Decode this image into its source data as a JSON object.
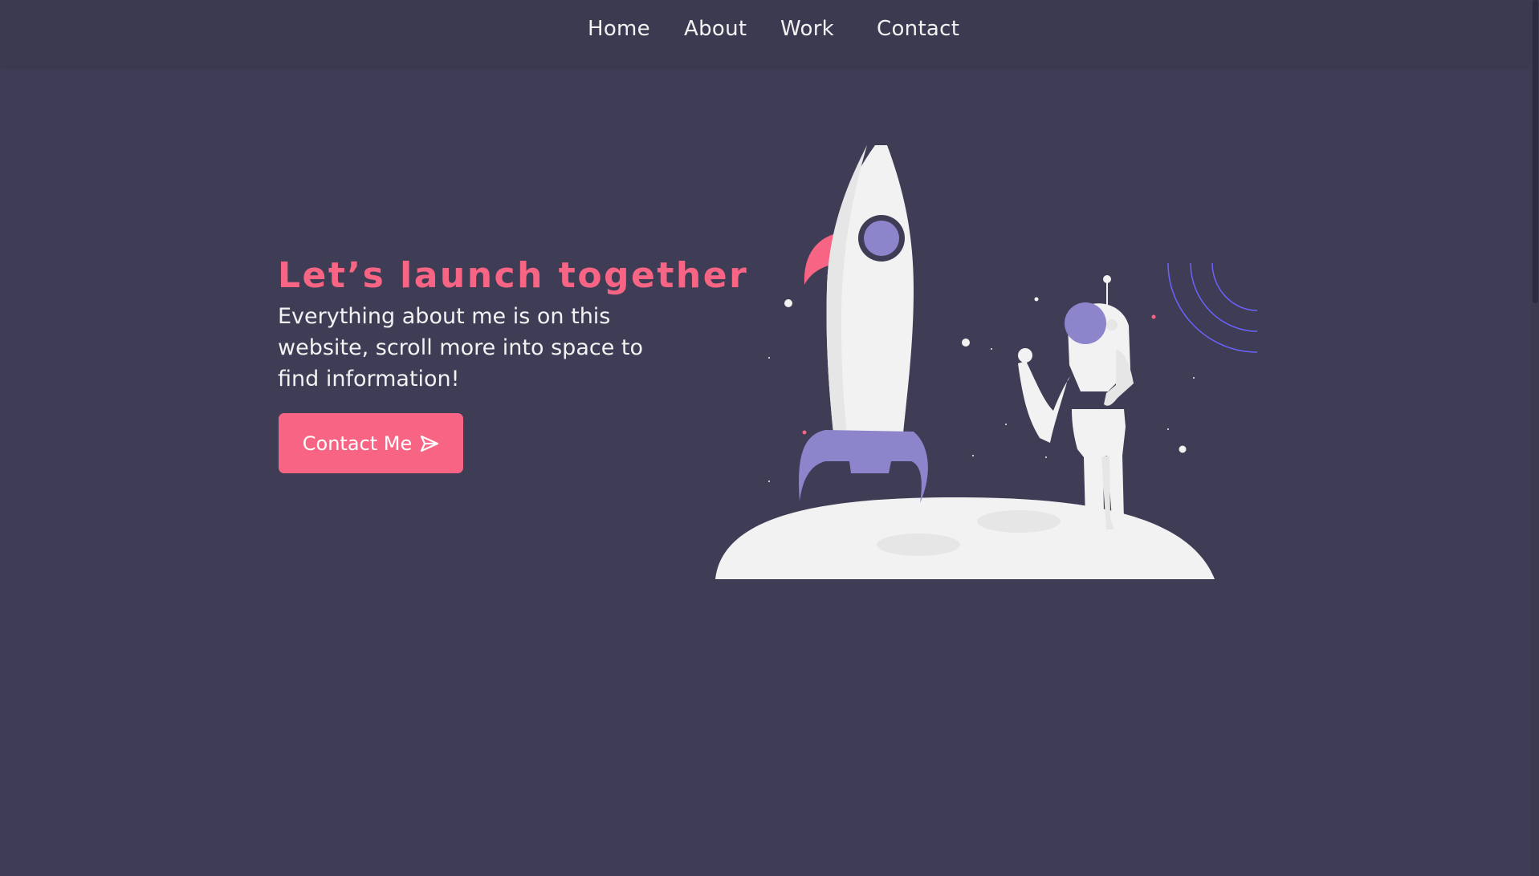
{
  "nav": {
    "items": [
      {
        "id": "home",
        "label": "Home"
      },
      {
        "id": "about",
        "label": "About"
      },
      {
        "id": "work",
        "label": "Work"
      },
      {
        "id": "contact",
        "label": "Contact"
      }
    ]
  },
  "hero": {
    "title": "Let’s launch together",
    "description": "Everything about me is on this website, scroll more into space to find information!",
    "cta_label": "Contact Me",
    "cta_icon": "send-icon"
  },
  "illustration": {
    "name": "rocket-astronaut-moon-illustration"
  },
  "colors": {
    "background": "#3f3d56",
    "navbar": "#3c3a51",
    "accent": "#f86584",
    "text": "#f2f2f2",
    "purple": "#8c85cc",
    "signal": "#6c63ff"
  }
}
